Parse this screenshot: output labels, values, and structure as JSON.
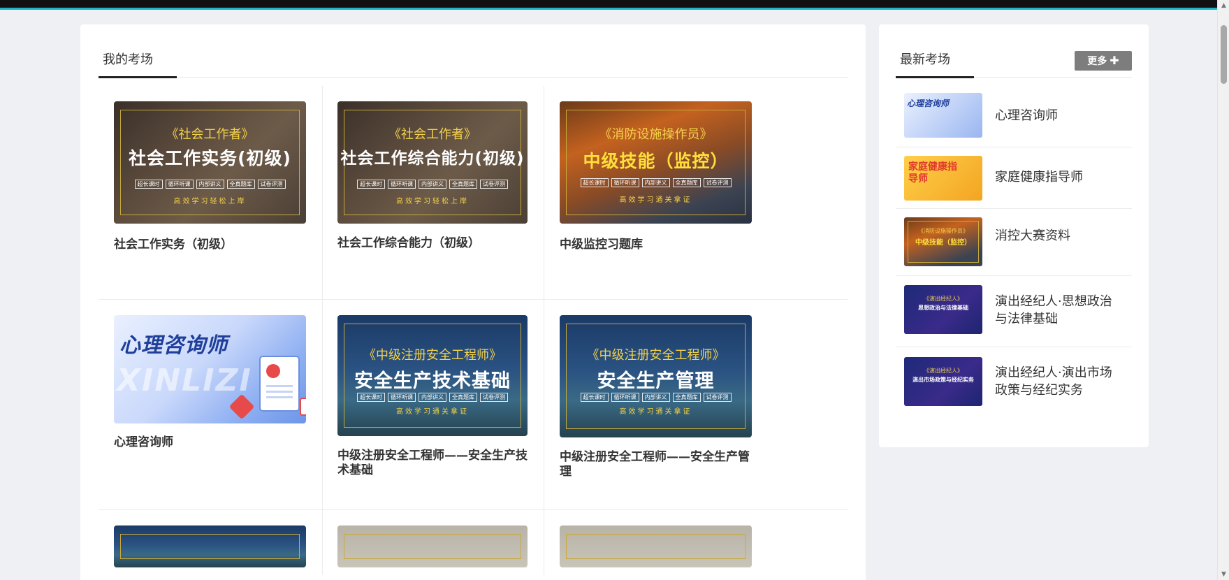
{
  "my_exams": {
    "title": "我的考场",
    "cards": [
      {
        "title": "社会工作实务（初级）",
        "cover_sub": "《社会工作者》",
        "cover_main": "社会工作实务(初级)",
        "cover_slogan": "高效学习轻松上岸"
      },
      {
        "title": "社会工作综合能力（初级）",
        "cover_sub": "《社会工作者》",
        "cover_main": "社会工作综合能力(初级)",
        "cover_slogan": "高效学习轻松上岸"
      },
      {
        "title": "中级监控习题库",
        "cover_sub": "《消防设施操作员》",
        "cover_main": "中级技能（监控）",
        "cover_slogan": "高效学习通关拿证"
      },
      {
        "title": "心理咨询师",
        "cover_main": "心理咨询师",
        "cover_watermark": "XINLIZI"
      },
      {
        "title": "中级注册安全工程师——安全生产技术基础",
        "cover_sub": "《中级注册安全工程师》",
        "cover_main": "安全生产技术基础",
        "cover_slogan": "高效学习通关拿证"
      },
      {
        "title": "中级注册安全工程师——安全生产管理",
        "cover_sub": "《中级注册安全工程师》",
        "cover_main": "安全生产管理",
        "cover_slogan": "高效学习通关拿证"
      }
    ],
    "cover_tags": [
      "超长课时",
      "循环听课",
      "内部讲义",
      "全真题库",
      "试卷评测"
    ]
  },
  "latest_exams": {
    "title": "最新考场",
    "more_label": "更多",
    "more_icon": "plus-icon",
    "items": [
      {
        "name": "心理咨询师",
        "thumb_label": "心理咨询师"
      },
      {
        "name": "家庭健康指导师",
        "thumb_label": "家庭健康指导师"
      },
      {
        "name": "消控大赛资料",
        "thumb_sub": "《消防设施操作员》",
        "thumb_main": "中级技能（监控）"
      },
      {
        "name": "演出经纪人·思想政治与法律基础",
        "thumb_sub": "《演出经纪人》",
        "thumb_main": "思想政治与法律基础"
      },
      {
        "name": "演出经纪人·演出市场政策与经纪实务",
        "thumb_sub": "《演出经纪人》",
        "thumb_main": "演出市场政策与经纪实务"
      }
    ]
  },
  "colors": {
    "page_bg": "#eef0f3",
    "top_accent": "#1fb3c8",
    "more_button_bg": "#7d7d7d",
    "cover_gold": "#f5d24a"
  }
}
